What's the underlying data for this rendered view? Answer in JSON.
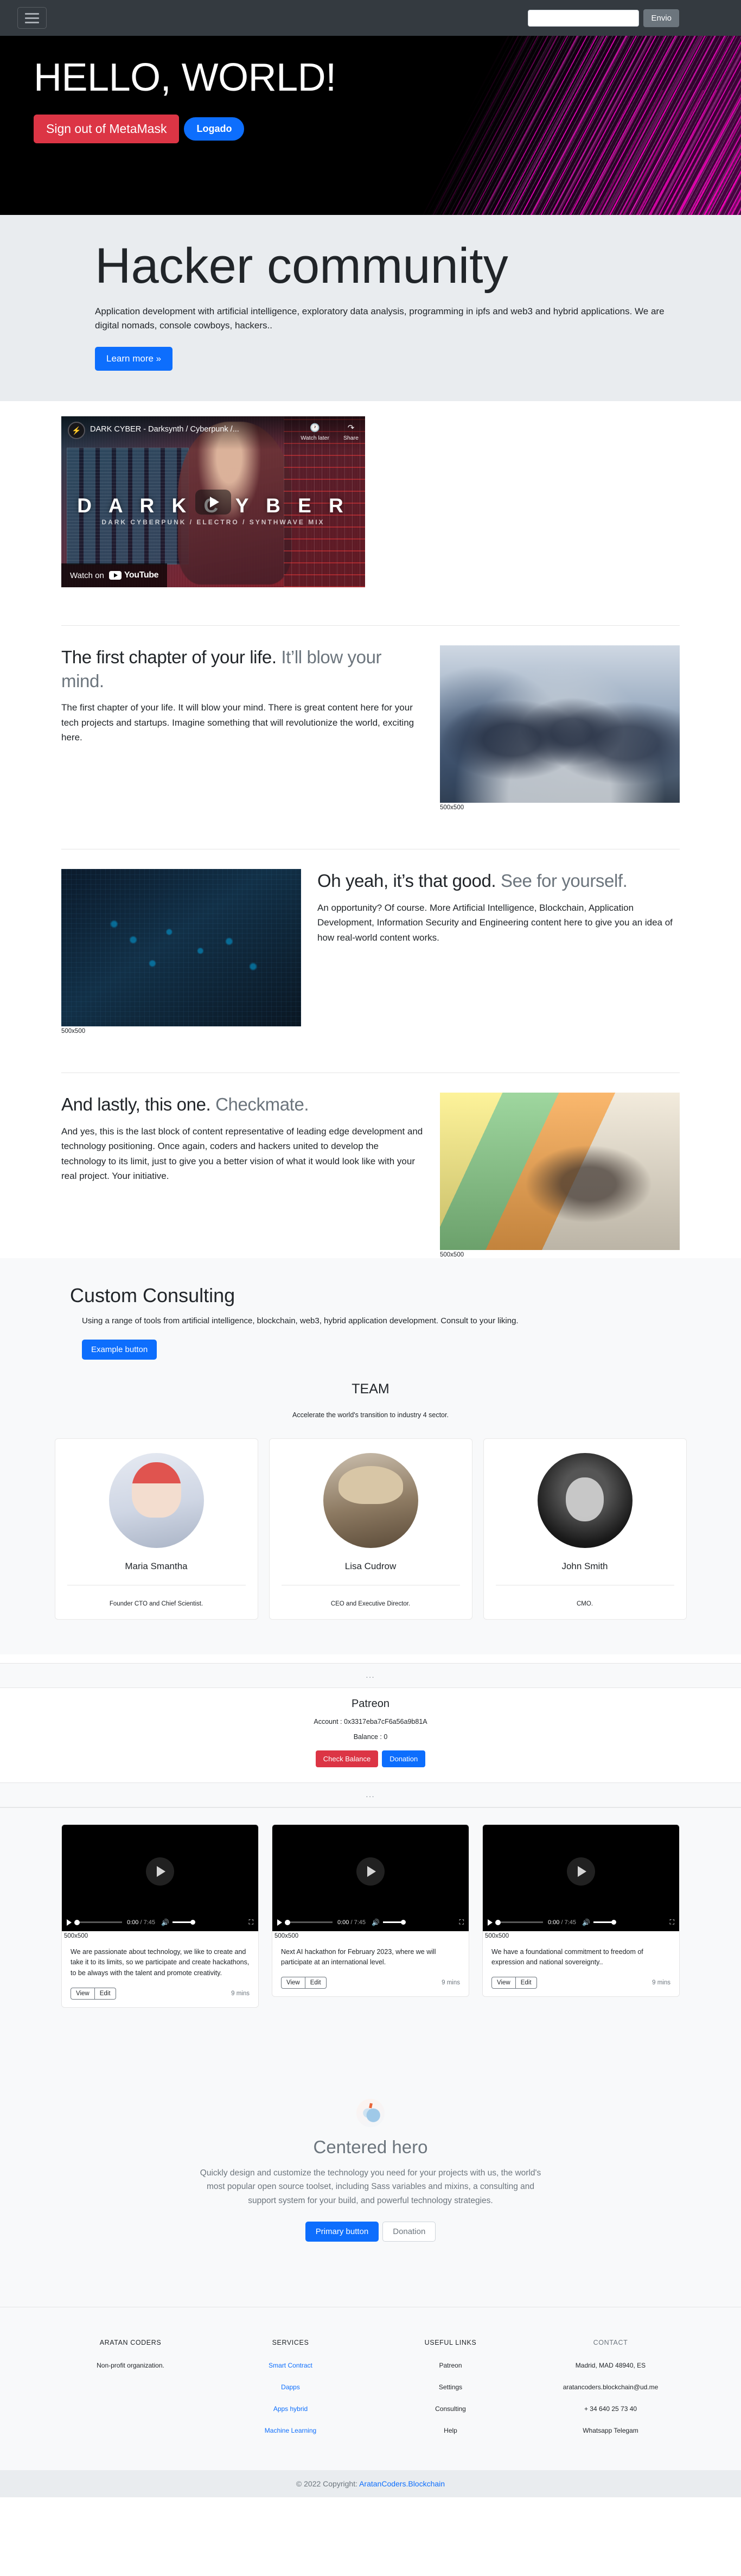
{
  "navbar": {
    "toggler_label": "menu",
    "search_value": "",
    "search_placeholder": "",
    "submit_label": "Envio"
  },
  "hero": {
    "title": "HELLO, WORLD!",
    "signout_label": "Sign out of MetaMask",
    "status_label": "Logado"
  },
  "jumbotron": {
    "title": "Hacker community",
    "lead": "Application development with artificial intelligence, exploratory data analysis, programming in ipfs and web3 and hybrid applications. We are digital nomads, console cowboys, hackers..",
    "cta_label": "Learn more »"
  },
  "video_embed": {
    "title": "DARK CYBER - Darksynth / Cyberpunk /...",
    "watch_later": "Watch later",
    "share": "Share",
    "overlay_title": "D A R K   C Y B E R",
    "overlay_subtitle": "DARK CYBERPUNK / ELECTRO / SYNTHWAVE MIX",
    "watch_on": "Watch on",
    "platform": "YouTube"
  },
  "featurettes": [
    {
      "heading_main": "The first chapter of your life.",
      "heading_muted": "It’ll blow your mind.",
      "body": "The first chapter of your life. It will blow your mind. There is great content here for your tech projects and startups. Imagine something that will revolutionize the world, exciting here.",
      "image_caption": "500x500"
    },
    {
      "heading_main": "Oh yeah, it’s that good.",
      "heading_muted": "See for yourself.",
      "body": "An opportunity? Of course. More Artificial Intelligence, Blockchain, Application Development, Information Security and Engineering content here to give you an idea of how real-world content works.",
      "image_caption": "500x500"
    },
    {
      "heading_main": "And lastly, this one.",
      "heading_muted": "Checkmate.",
      "body": "And yes, this is the last block of content representative of leading edge development and technology positioning. Once again, coders and hackers united to develop the technology to its limit, just to give you a better vision of what it would look like with your real project. Your initiative.",
      "image_caption": "500x500"
    }
  ],
  "consulting": {
    "title": "Custom Consulting",
    "body": "Using a range of tools from artificial intelligence, blockchain, web3, hybrid application development. Consult to your liking.",
    "button_label": "Example button"
  },
  "team": {
    "title": "TEAM",
    "subtitle": "Accelerate the world's transition to industry 4 sector.",
    "members": [
      {
        "name": "Maria Smantha",
        "role": "Founder CTO and Chief Scientist."
      },
      {
        "name": "Lisa Cudrow",
        "role": "CEO and Executive Director."
      },
      {
        "name": "John Smith",
        "role": "CMO."
      }
    ]
  },
  "patreon": {
    "bar_text": "...",
    "title": "Patreon",
    "account_label": "Account :",
    "account_value": "0x3317eba7cF6a56a9b81A",
    "balance_label": "Balance :",
    "balance_value": "0",
    "check_balance_label": "Check Balance",
    "donation_label": "Donation"
  },
  "video_cards": {
    "player": {
      "current_time": "0:00",
      "separator": "/",
      "duration": "7:45",
      "caption": "500x500"
    },
    "cards": [
      {
        "text": "We are passionate about technology, we like to create and take it to its limits, so we participate and create hackathons, to be always with the talent and promote creativity.",
        "view_label": "View",
        "edit_label": "Edit",
        "meta": "9 mins"
      },
      {
        "text": "Next AI hackathon for February 2023, where we will participate at an international level.",
        "view_label": "View",
        "edit_label": "Edit",
        "meta": "9 mins"
      },
      {
        "text": "We have a foundational commitment to freedom of expression and national sovereignty..",
        "view_label": "View",
        "edit_label": "Edit",
        "meta": "9 mins"
      }
    ]
  },
  "centered_hero": {
    "logo_name": "bootstrap-logo-icon",
    "title": "Centered hero",
    "body": "Quickly design and customize the technology you need for your projects with us, the world's most popular open source toolset, including Sass variables and mixins, a consulting and support system for your build, and powerful technology strategies.",
    "primary_label": "Primary button",
    "secondary_label": "Donation"
  },
  "footer": {
    "columns": [
      {
        "heading": "ARATAN CODERS",
        "items": [
          {
            "label": "Non-profit organization.",
            "link": false
          }
        ]
      },
      {
        "heading": "SERVICES",
        "items": [
          {
            "label": "Smart Contract",
            "link": true
          },
          {
            "label": "Dapps",
            "link": true
          },
          {
            "label": "Apps hybrid",
            "link": true
          },
          {
            "label": "Machine Learning",
            "link": true
          }
        ]
      },
      {
        "heading": "USEFUL LINKS",
        "items": [
          {
            "label": "Patreon",
            "link": false
          },
          {
            "label": "Settings",
            "link": false
          },
          {
            "label": "Consulting",
            "link": false
          },
          {
            "label": "Help",
            "link": false
          }
        ]
      },
      {
        "heading": "CONTACT",
        "items": [
          {
            "label": "Madrid, MAD 48940, ES",
            "link": false
          },
          {
            "label": "aratancoders.blockchain@ud.me",
            "link": false
          },
          {
            "label": "+ 34 640 25 73 40",
            "link": false
          },
          {
            "label": "Whatsapp Telegam",
            "link": false
          }
        ]
      }
    ],
    "copyright_prefix": "© 2022 Copyright:",
    "copyright_link": "AratanCoders.Blockchain"
  },
  "colors": {
    "navbar_bg": "#343a40",
    "primary": "#0d6efd",
    "danger": "#dc3545",
    "secondary": "#6c757d",
    "jumbotron_bg": "#e9ecef",
    "light_bg": "#f8f9fa"
  }
}
